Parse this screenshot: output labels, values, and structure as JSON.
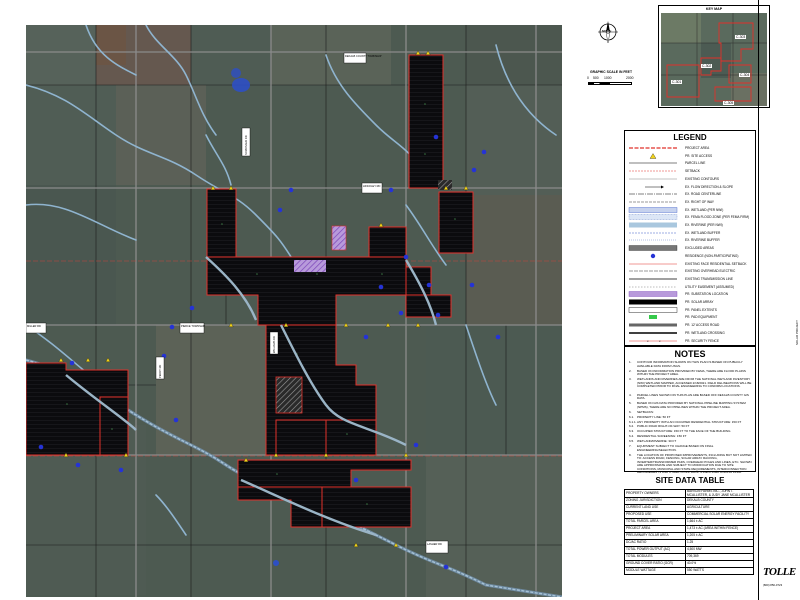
{
  "key_map": {
    "title": "KEY MAP",
    "labels": [
      "C-303",
      "C-302",
      "C-304",
      "C-301",
      "C-305"
    ]
  },
  "north_arrow": {
    "label": "NORTH"
  },
  "graphic_scale": {
    "title": "GRAPHIC SCALE IN FEET",
    "ticks": [
      "0",
      "500",
      "1000",
      "2000"
    ]
  },
  "legend": {
    "title": "LEGEND",
    "items": [
      {
        "label": "PROJECT AREA",
        "icon": "red-dashed-line"
      },
      {
        "label": "PR. SITE ACCESS",
        "icon": "yellow-triangle"
      },
      {
        "label": "PARCEL LINE",
        "icon": "black-line"
      },
      {
        "label": "SETBACK",
        "icon": "red-thin-line"
      },
      {
        "label": "EXISTING CONTOURS",
        "icon": "grey-line"
      },
      {
        "label": "EX. FLOW DIRECTION & SLOPE",
        "icon": "arrow"
      },
      {
        "label": "EX. ROAD CENTERLINE",
        "icon": "dash-dot-line"
      },
      {
        "label": "EX. RIGHT OF WAY",
        "icon": "row-line"
      },
      {
        "label": "EX. WETLAND (PER NWI)",
        "icon": "blue-hatch"
      },
      {
        "label": "EX. FEMA FLOOD ZONE (PER FEMA FIRM)",
        "icon": "blue-hatch-2"
      },
      {
        "label": "EX. RIVERINE (PER NWI)",
        "icon": "lightblue-fill"
      },
      {
        "label": "EX. WETLAND BUFFER",
        "icon": "blue-dash"
      },
      {
        "label": "EX. RIVERINE BUFFER",
        "icon": "blue-dash-2"
      },
      {
        "label": "EXCLUDED AREAS",
        "icon": "grey-hatch"
      },
      {
        "label": "RESIDENCE (NON-PARTICIPATING)",
        "icon": "blue-dot"
      },
      {
        "label": "EXISTING FACE RESIDENTIAL SETBACK",
        "icon": "red-line"
      },
      {
        "label": "EXISTING OVERHEAD ELECTRIC",
        "icon": "oh-line"
      },
      {
        "label": "EXISTING TRANSMISSION LINE",
        "icon": "tx-line"
      },
      {
        "label": "UTILITY EASEMENT (ASSUMED)",
        "icon": "dashed-line"
      },
      {
        "label": "PR. SUBSTATION LOCATION",
        "icon": "purple-hatch"
      },
      {
        "label": "PR. SOLAR ARRAY",
        "icon": "black-rect"
      },
      {
        "label": "PR. PANEL EXTENTS",
        "icon": "thin-rect"
      },
      {
        "label": "PR. PAD EQUIPMENT",
        "icon": "green-rect"
      },
      {
        "label": "PR. 12' ACCESS ROAD",
        "icon": "access-road"
      },
      {
        "label": "PR. WETLAND CROSSING",
        "icon": "crossing"
      },
      {
        "label": "PR. SECURITY FENCE",
        "icon": "fence-line"
      }
    ]
  },
  "notes": {
    "title": "NOTES",
    "items": [
      {
        "num": "1.",
        "text": "CONTOUR INFORMATION SHOWN ON THIS PLAN IS BASED ON PUBLICLY AVAILABLE DATA FROM USGS."
      },
      {
        "num": "2.",
        "text": "BASED ON INFORMATION PROVIDED BY FEMA, THERE ARE FLOOD PLAINS WITHIN THE PROJECT AREA."
      },
      {
        "num": "3.",
        "text": "WETLANDS AND RIVERINES ARE FROM THE NATIONAL WETLAND INVENTORY (NWI) WETLAND MAPPER, ACCESSED 2/18/2021. FIELD DELINEATIONS WILL BE COMPLETED PRIOR TO FINAL ENGINEERING TO CONFIRM LOCATIONS."
      },
      {
        "num": "4.",
        "text": "PARCEL LINES SHOWN ON THIS PLAN ARE BASED OFF DEKALB COUNTY GIS DATA."
      },
      {
        "num": "5.",
        "text": "BASED ON GIS DATA PROVIDED BY NATIONAL PIPELINE MAPPING SYSTEM (NPMS), THERE ARE NO PIPELINES WITHIN THE PROJECT AREA."
      },
      {
        "num": "6.",
        "text": "SETBACKS:"
      },
      {
        "num": "6.1.",
        "text": "PROPERTY LINE: 50 FT"
      },
      {
        "num": "6.1.1.",
        "text": "ANY PROPERTY WITH AN OCCUPIED RESIDENTIAL STRUCTURE: 150 FT"
      },
      {
        "num": "6.2.",
        "text": "PUBLIC ROAD RIGHT-OF-WAY: 50 FT"
      },
      {
        "num": "6.3.",
        "text": "OCCUPIED STRUCTURE: 150 FT TO THE FACE OF THE BUILDING"
      },
      {
        "num": "6.4.",
        "text": "RESIDENTIAL SCREENING: 150 FT"
      },
      {
        "num": "6.5.",
        "text": "WETLAND/RIVERINE: 30 FT"
      },
      {
        "num": "7.",
        "text": "EQUIPMENT SUBJECT TO CHANGE BASED ON FINAL ENGINEERING/SELECTION."
      },
      {
        "num": "8.",
        "text": "THE LOCATION OF PROPOSED IMPROVEMENTS, INCLUDING BUT NOT LIMITED TO: ACCESS ROAD, FENCING, SOLAR ARRAY RACKING, INVERTER/TRANSFORMER PADS, OVERHEAD POLES AND LINES, ETC. SHOWN ARE APPROXIMATE AND SUBJECT TO MODIFICATION DUE TO SITE CONDITIONS, MUNICIPAL AND STATE REQUIREMENTS, INTERCONNECTION REQUIREMENTS AND OTHER CONSTRAINTS IDENTIFIED DURING FINAL ENGINEERING."
      },
      {
        "num": "9.",
        "text": "THE UNUSED SUBSTATION LOCATION WILL BE FILLED WITH PANELS, AN INVERTER, AND OTHER INFRASTRUCTURE."
      }
    ]
  },
  "site_data_table": {
    "title": "SITE DATA TABLE",
    "rows": [
      {
        "key": "PROPERTY OWNERS",
        "value": "BARSON FARMS INC., JOHN T. MCALLISTER, & JUDY JANE MCALLISTER"
      },
      {
        "key": "ZONING JURISDICTION",
        "value": "DEKALB COUNTY"
      },
      {
        "key": "CURRENT LAND USE",
        "value": "AGRICULTURE"
      },
      {
        "key": "PROPOSED USE",
        "value": "COMMERCIAL SOLAR ENERGY FACILITY"
      },
      {
        "key": "TOTAL PARCEL AREA",
        "value": "1,664 ± AC"
      },
      {
        "key": "PROJECT AREA",
        "value": "1,473 ± AC (AREA WITHIN FENCE)"
      },
      {
        "key": "PRELIMINARY SOLAR AREA",
        "value": "1,205 ± AC"
      },
      {
        "key": "DC/AC RATIO",
        "value": "1.25"
      },
      {
        "key": "TOTAL POWER OUTPUT (AC)",
        "value": "4,500 MW"
      },
      {
        "key": "TOTAL MODULES",
        "value": "709,369"
      },
      {
        "key": "GROUND COVER RATIO (GCR)",
        "value": "40.0%"
      },
      {
        "key": "MODULE WATTAGE",
        "value": "550 WATTS"
      }
    ]
  },
  "title_block": {
    "logo": "TOLLE",
    "phone": "(800) 850-0723",
    "sheet_label": "SOLAR PROJECT"
  },
  "map": {
    "road_labels": [
      "DEKALB COUNTY TOWNSHIP",
      "PIERCE TOWNSHIP",
      "MILLER RD",
      "LASHER RD",
      "SOMONAUK RD",
      "HINCKLEY RD",
      "WILLIAMS RD",
      "PERRY RD"
    ],
    "array_label": "C",
    "colors": {
      "aerial": "#4e5a52",
      "project_boundary": "#e0302a",
      "panel_blocks": "#0b0b0e",
      "water": "#8fb4cf",
      "substation": "#8f5fc0",
      "site_access": "#f0d21a",
      "residence": "#2533d6"
    }
  }
}
